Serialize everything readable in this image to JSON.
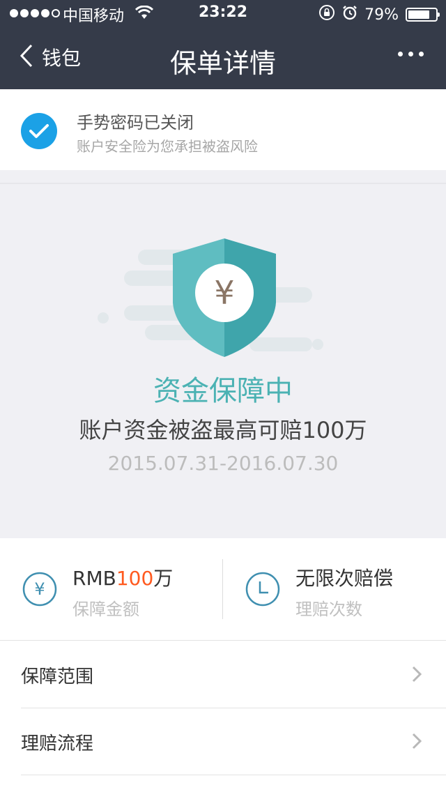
{
  "status_bar": {
    "carrier": "中国移动",
    "time": "23:22",
    "battery_percent": "79%",
    "battery_level": 0.79
  },
  "nav": {
    "back_label": "钱包",
    "title": "保单详情"
  },
  "banner": {
    "title": "手势密码已关闭",
    "subtitle": "账户安全险为您承担被盗风险"
  },
  "hero": {
    "currency_symbol": "¥",
    "status": "资金保障中",
    "description": "账户资金被盗最高可赔100万",
    "period": "2015.07.31-2016.07.30"
  },
  "stats": {
    "amount": {
      "prefix": "RMB",
      "value": "100",
      "suffix": "万",
      "label": "保障金额",
      "icon_symbol": "¥"
    },
    "claims": {
      "value": "无限次赔偿",
      "label": "理赔次数"
    }
  },
  "menu": [
    {
      "label": "保障范围"
    },
    {
      "label": "理赔流程"
    }
  ],
  "colors": {
    "header_bg": "#353b49",
    "accent_teal": "#4bb2b3",
    "check_blue": "#1ba1e6",
    "highlight_orange": "#ff5a1f",
    "hero_bg": "#f0f0f4"
  }
}
